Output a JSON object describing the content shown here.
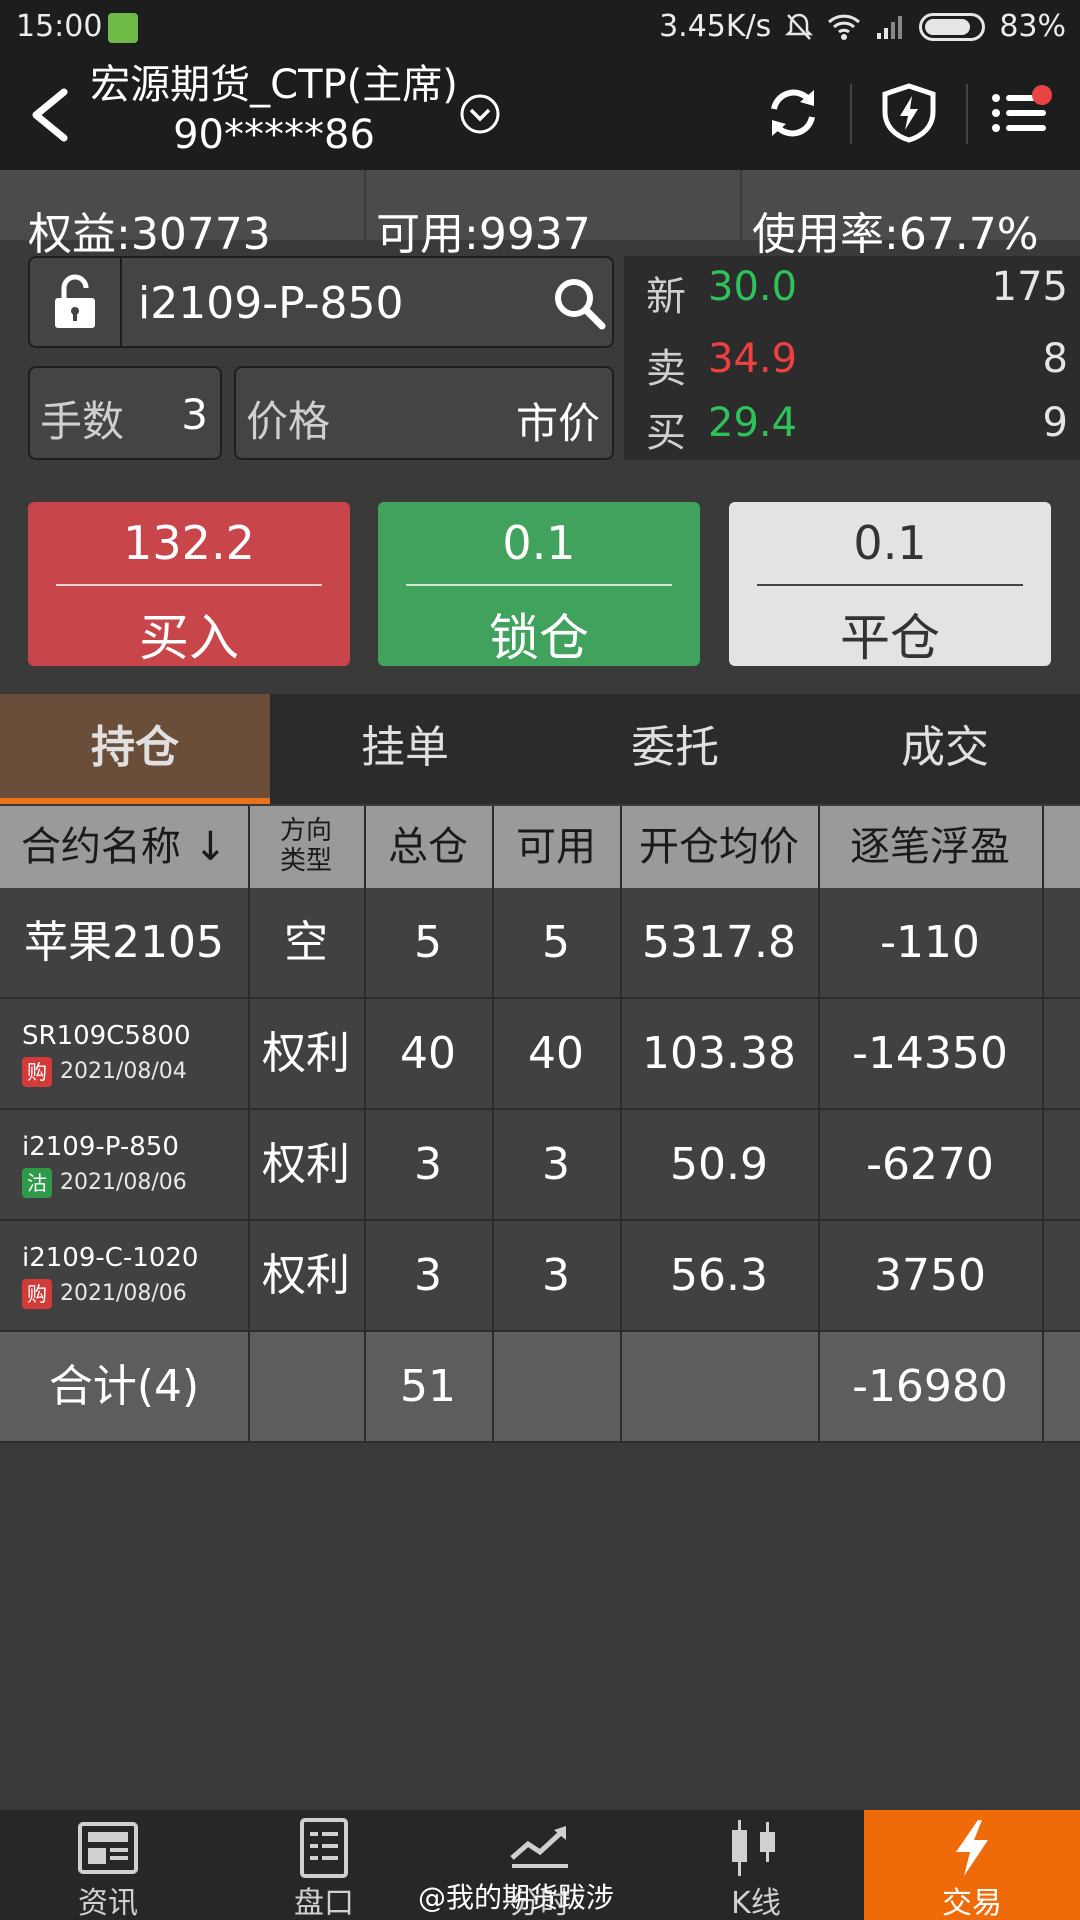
{
  "status": {
    "time": "15:00",
    "speed": "3.45K/s",
    "battery": "83%",
    "battery_level": 0.83
  },
  "header": {
    "title_line1": "宏源期货_CTP(主席)",
    "title_line2": "90*****86"
  },
  "account": {
    "equity": "权益:30773",
    "available": "可用:9937",
    "usage": "使用率:67.7%"
  },
  "order": {
    "symbol": "i2109-P-850",
    "lots_label": "手数",
    "lots_value": "3",
    "price_label": "价格",
    "price_value": "市价"
  },
  "quote": {
    "last_label": "新",
    "last_price": "30.0",
    "last_vol": "175",
    "ask_label": "卖",
    "ask_price": "34.9",
    "ask_vol": "8",
    "bid_label": "买",
    "bid_price": "29.4",
    "bid_vol": "9"
  },
  "actions": {
    "buy_price": "132.2",
    "buy_label": "买入",
    "lock_price": "0.1",
    "lock_label": "锁仓",
    "close_price": "0.1",
    "close_label": "平仓"
  },
  "tabs": [
    "持仓",
    "挂单",
    "委托",
    "成交"
  ],
  "table": {
    "headers": {
      "name": "合约名称",
      "sort_arrow": "↓",
      "dir_line1": "方向",
      "dir_line2": "类型",
      "total": "总仓",
      "avail": "可用",
      "avg": "开仓均价",
      "pnl": "逐笔浮盈"
    },
    "rows": [
      {
        "name": "苹果2105",
        "dir": "空",
        "total": "5",
        "avail": "5",
        "avg": "5317.8",
        "pnl": "-110"
      },
      {
        "name": "SR109C5800",
        "tag": "购",
        "date": "2021/08/04",
        "dir": "权利",
        "total": "40",
        "avail": "40",
        "avg": "103.38",
        "pnl": "-14350"
      },
      {
        "name": "i2109-P-850",
        "tag": "沽",
        "date": "2021/08/06",
        "dir": "权利",
        "total": "3",
        "avail": "3",
        "avg": "50.9",
        "pnl": "-6270"
      },
      {
        "name": "i2109-C-1020",
        "tag": "购",
        "date": "2021/08/06",
        "dir": "权利",
        "total": "3",
        "avail": "3",
        "avg": "56.3",
        "pnl": "3750"
      }
    ],
    "total": {
      "label": "合计(4)",
      "total": "51",
      "pnl": "-16980"
    }
  },
  "nav": [
    "资讯",
    "盘口",
    "分时",
    "K线",
    "交易"
  ],
  "watermark": "@我的期货跋涉",
  "colors": {
    "accent": "#ef6b0a",
    "buy": "#c8454a",
    "lock": "#41a25e",
    "up": "#ef4040",
    "down": "#2fc25b"
  }
}
